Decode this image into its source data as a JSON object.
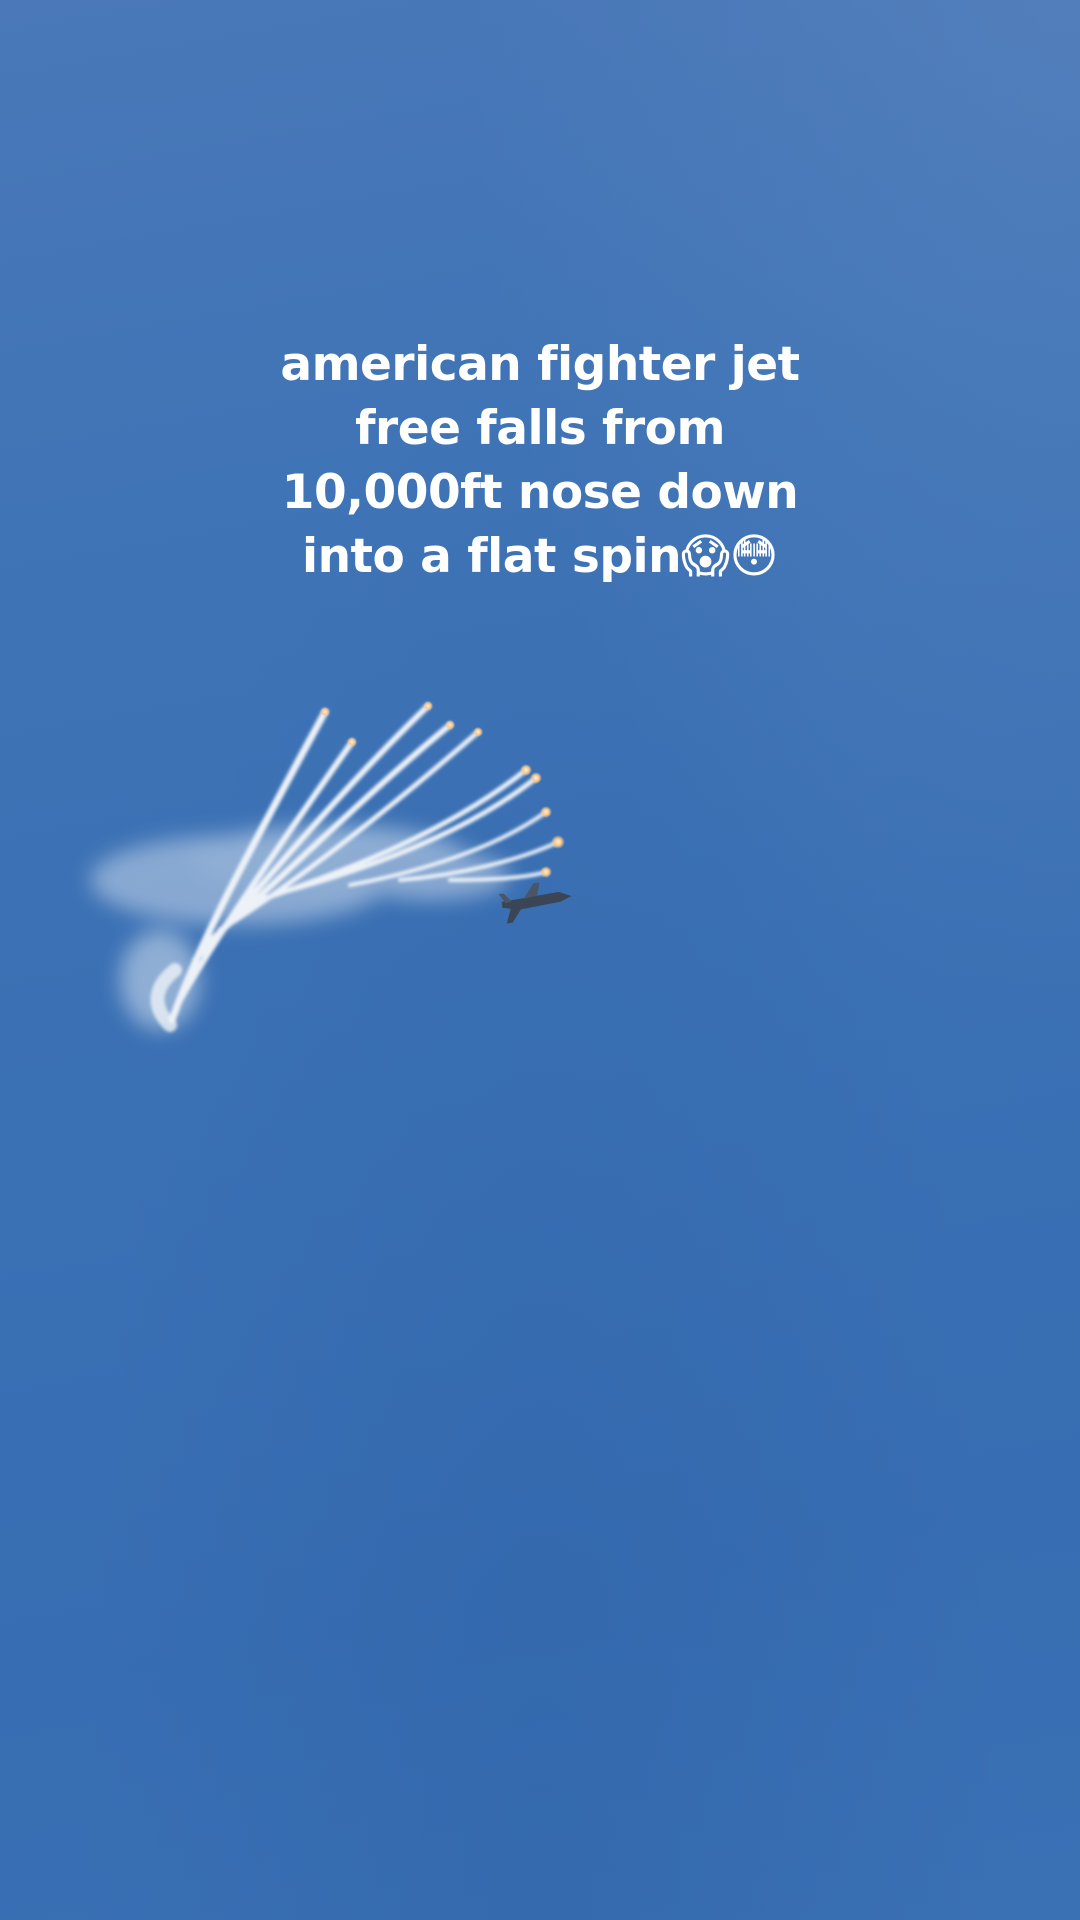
{
  "caption": {
    "line1": "american fighter jet",
    "line2": "free falls from",
    "line3": "10,000ft nose down",
    "line4": "into a flat spin😱😳"
  },
  "colors": {
    "sky": "#3a70b4",
    "caption_text": "#ffffff",
    "smoke": "#e8eef6",
    "flare": "#ffd9a8"
  },
  "scene": {
    "subject": "fighter-jet-icon",
    "effects": "flare-smoke-trails"
  }
}
